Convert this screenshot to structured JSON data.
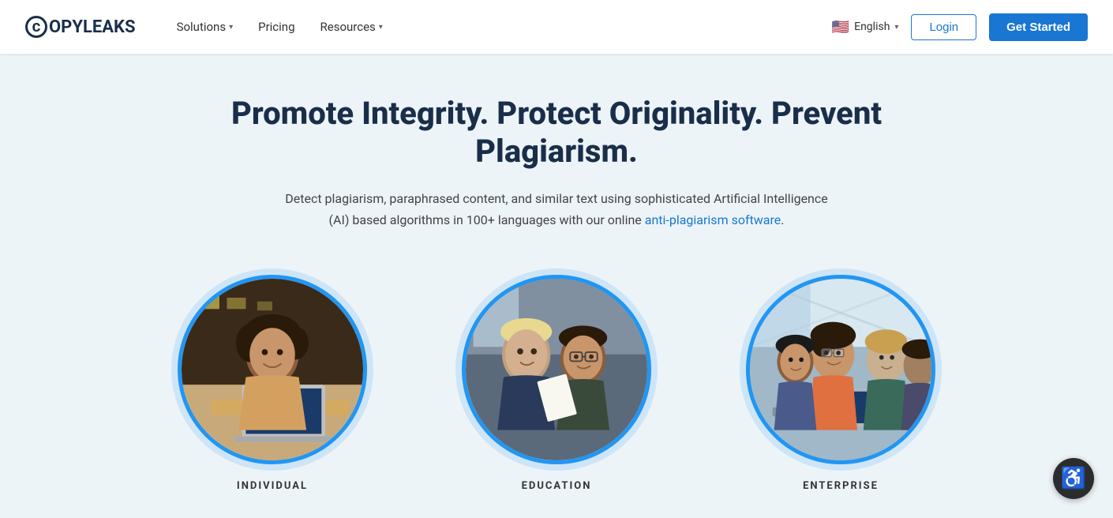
{
  "brand": {
    "logo_letter": "C",
    "logo_name": "OPYLEAKS"
  },
  "navbar": {
    "solutions_label": "Solutions",
    "pricing_label": "Pricing",
    "resources_label": "Resources",
    "language_name": "English",
    "login_label": "Login",
    "get_started_label": "Get Started"
  },
  "hero": {
    "title": "Promote Integrity. Protect Originality. Prevent Plagiarism.",
    "subtitle_before_link": "Detect plagiarism, paraphrased content, and similar text using sophisticated Artificial Intelligence\n(AI) based algorithms in 100+ languages with our online ",
    "subtitle_link": "anti-plagiarism software",
    "subtitle_after_link": "."
  },
  "circles": [
    {
      "id": "individual",
      "label": "INDIVIDUAL",
      "alt": "Individual user with laptop"
    },
    {
      "id": "education",
      "label": "EDUCATION",
      "alt": "Two educators collaborating"
    },
    {
      "id": "enterprise",
      "label": "ENTERPRISE",
      "alt": "Enterprise team working together"
    }
  ],
  "accessibility": {
    "label": "Accessibility"
  }
}
